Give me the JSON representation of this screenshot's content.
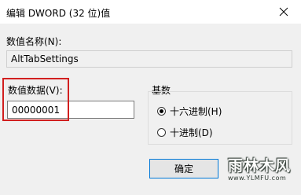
{
  "window": {
    "title": "编辑 DWORD (32 位)值",
    "close_icon": "close-icon"
  },
  "value_name": {
    "label": "数值名称(N):",
    "value": "AltTabSettings"
  },
  "value_data": {
    "label": "数值数据(V):",
    "value": "00000001"
  },
  "base": {
    "label": "基数",
    "options": [
      {
        "label": "十六进制(H)",
        "selected": true
      },
      {
        "label": "十进制(D)",
        "selected": false
      }
    ]
  },
  "buttons": {
    "ok_label": "确定"
  },
  "watermark": {
    "text": "雨林木风",
    "url": "www.YLMFU.com"
  },
  "colors": {
    "highlight": "#d11f1f",
    "accent": "#0078d7",
    "background": "#f0f0f0"
  }
}
